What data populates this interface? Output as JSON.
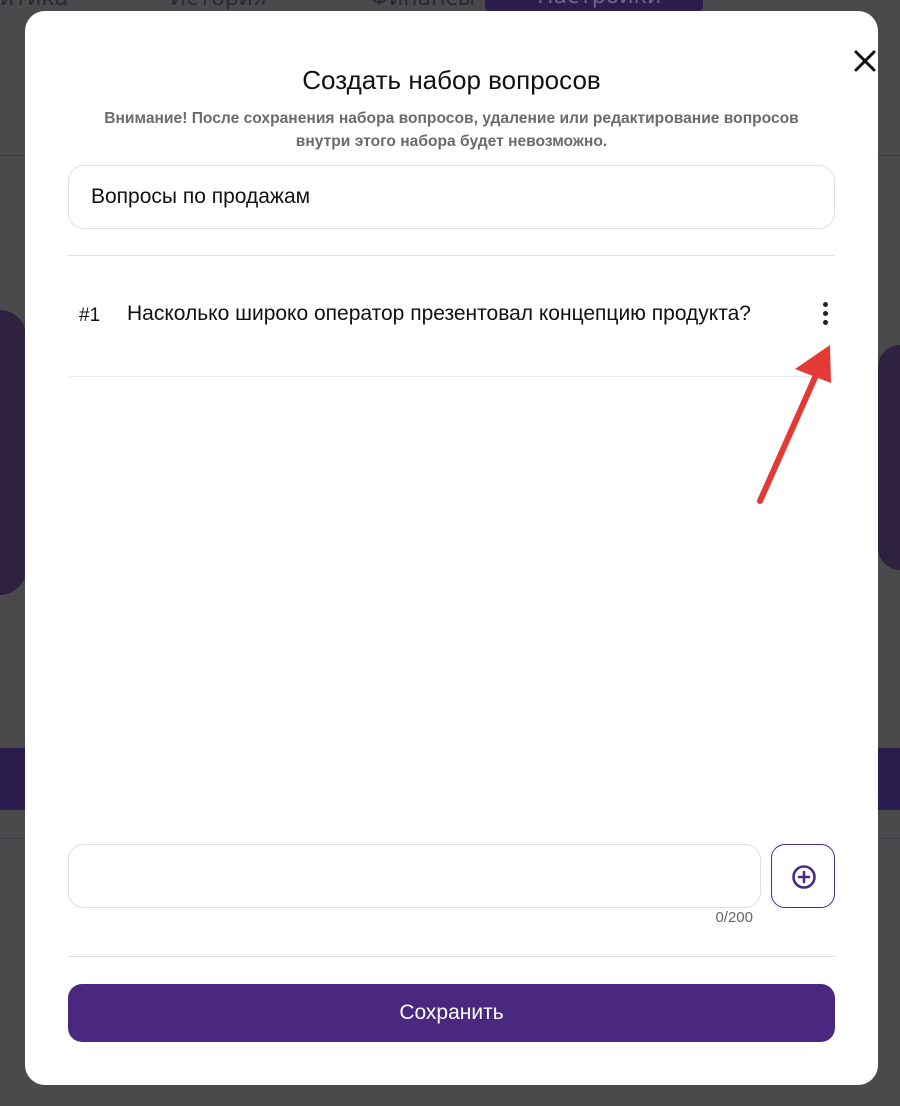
{
  "background": {
    "nav_items": [
      "итика",
      "История",
      "Финансы"
    ],
    "settings_button": "Настройки"
  },
  "modal": {
    "title": "Создать набор вопросов",
    "warning": "Внимание! После сохранения набора вопросов, удаление или редактирование вопросов внутри этого набора будет невозможно.",
    "set_name_value": "Вопросы по продажам",
    "questions": [
      {
        "number": "#1",
        "text": "Насколько широко оператор презентовал концепцию продукта?"
      }
    ],
    "new_question_value": "",
    "new_question_counter": "0/200",
    "save_label": "Сохранить",
    "icons": {
      "close": "close-icon",
      "menu": "more-vertical-icon",
      "add": "plus-circle-icon"
    }
  },
  "colors": {
    "accent": "#4a2880",
    "annotation_arrow": "#e53935",
    "overlay": "#4a4a4d"
  }
}
